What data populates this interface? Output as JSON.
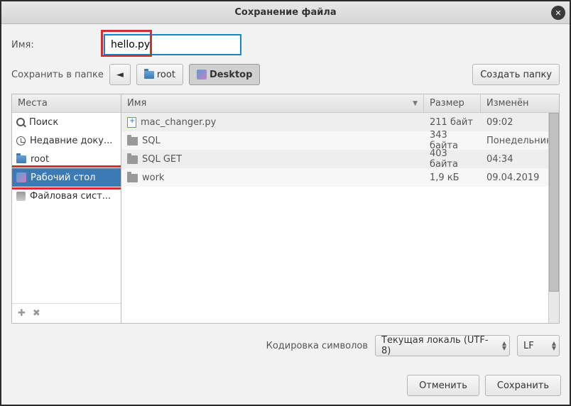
{
  "title": "Сохранение файла",
  "name_label": "Имя:",
  "filename": "hello.py",
  "save_in_label": "Сохранить в папке",
  "breadcrumbs": {
    "root": "root",
    "desktop": "Desktop"
  },
  "create_folder": "Создать папку",
  "places_header": "Места",
  "places": {
    "search": "Поиск",
    "recent": "Недавние доку...",
    "root": "root",
    "desktop": "Рабочий стол",
    "filesystem": "Файловая сист..."
  },
  "file_columns": {
    "name": "Имя",
    "size": "Размер",
    "modified": "Изменён"
  },
  "files": [
    {
      "name": "mac_changer.py",
      "size": "211 байт",
      "modified": "09:02",
      "type": "file"
    },
    {
      "name": "SQL",
      "size": "343 байта",
      "modified": "Понедельник",
      "type": "folder"
    },
    {
      "name": "SQL GET",
      "size": "403 байта",
      "modified": "04:34",
      "type": "folder"
    },
    {
      "name": "work",
      "size": "1,9 кБ",
      "modified": "09.04.2019",
      "type": "folder"
    }
  ],
  "encoding_label": "Кодировка символов",
  "encoding_value": "Текущая локаль (UTF-8)",
  "lineending_value": "LF",
  "cancel": "Отменить",
  "save": "Сохранить"
}
